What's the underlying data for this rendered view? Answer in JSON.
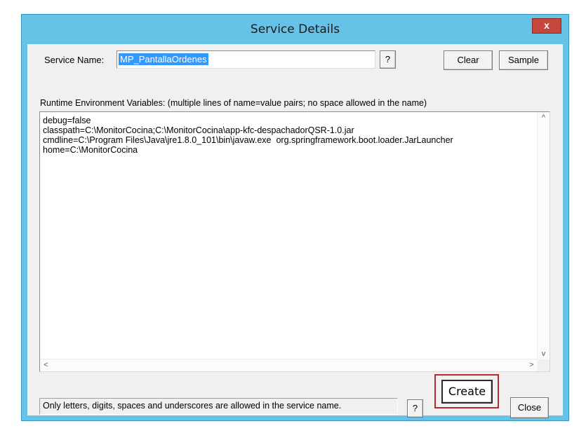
{
  "window": {
    "title": "Service Details",
    "close_glyph": "x"
  },
  "form": {
    "service_name_label": "Service Name:",
    "service_name_value": "MP_PantallaOrdenes",
    "help_glyph": "?",
    "clear_label": "Clear",
    "sample_label": "Sample",
    "env_label": "Runtime Environment Variables: (multiple lines of name=value pairs; no space allowed in the name)",
    "env_lines": [
      "debug=false",
      "classpath=C:\\MonitorCocina;C:\\MonitorCocina\\app-kfc-despachadorQSR-1.0.jar",
      "cmdline=C:\\Program Files\\Java\\jre1.8.0_101\\bin\\javaw.exe  org.springframework.boot.loader.JarLauncher",
      "home=C:\\MonitorCocina"
    ]
  },
  "scrollbars": {
    "up": "^",
    "down": "v",
    "left": "<",
    "right": ">"
  },
  "footer": {
    "status_text": "Only letters, digits, spaces and underscores are allowed in the service name.",
    "help_glyph": "?",
    "create_label": "Create",
    "close_label": "Close"
  },
  "colors": {
    "title_bar": "#66c2e6",
    "close_button": "#c7463b",
    "selection": "#3399ff",
    "highlight_box": "#b32c2c"
  }
}
